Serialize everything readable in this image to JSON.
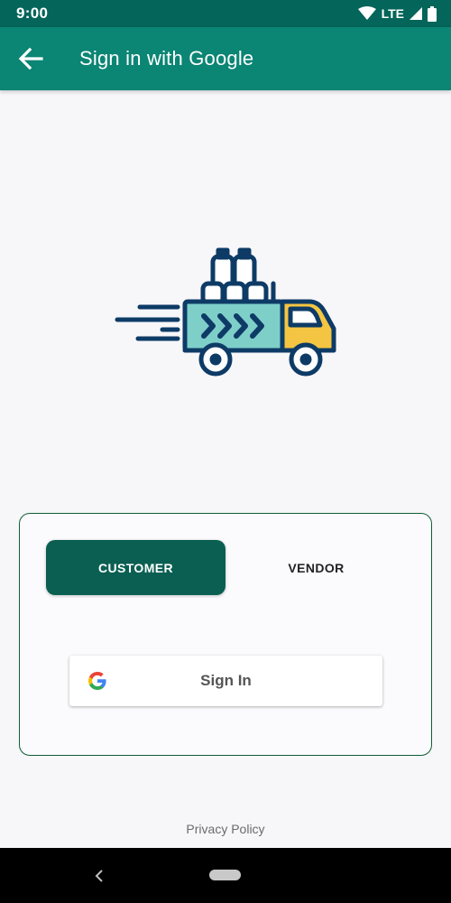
{
  "status_bar": {
    "time": "9:00",
    "network": "LTE",
    "icons": [
      "wifi-icon",
      "signal-icon",
      "battery-icon"
    ]
  },
  "app_bar": {
    "title": "Sign in with Google",
    "back_icon": "arrow-left-icon"
  },
  "illustration": {
    "icon": "delivery-truck-icon",
    "colors": {
      "outline": "#0d3b66",
      "cargo": "#7fcfc9",
      "cab": "#f4c542"
    }
  },
  "card": {
    "tabs": [
      {
        "label": "CUSTOMER",
        "selected": true
      },
      {
        "label": "VENDOR",
        "selected": false
      }
    ],
    "google_button": {
      "label": "Sign In",
      "icon": "google-g-icon"
    }
  },
  "footer": {
    "privacy_label": "Privacy Policy"
  },
  "nav_bar": {
    "icons": [
      "nav-back-icon",
      "nav-home-pill"
    ]
  },
  "colors": {
    "status_bar": "#04655a",
    "app_bar": "#0b8574",
    "accent": "#0a5f52",
    "card_border": "#0f5e35",
    "background": "#f7f6f9"
  }
}
